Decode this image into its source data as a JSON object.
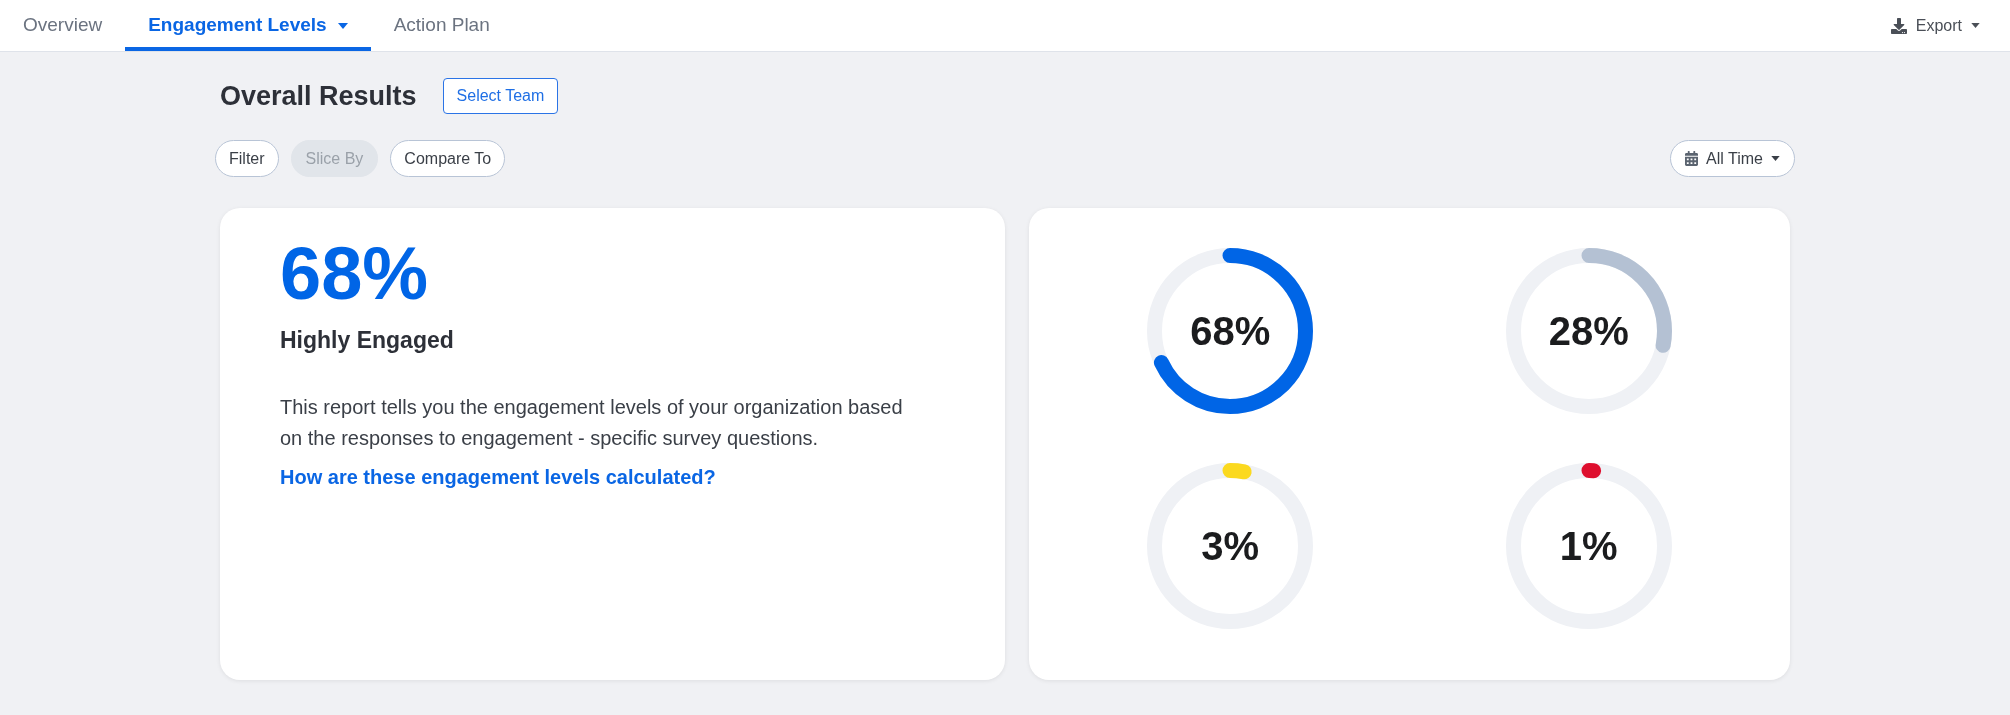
{
  "tabs": [
    {
      "label": "Overview",
      "selected": false,
      "dropdown": false
    },
    {
      "label": "Engagement Levels",
      "selected": true,
      "dropdown": true
    },
    {
      "label": "Action Plan",
      "selected": false,
      "dropdown": false
    }
  ],
  "export_button": {
    "label": "Export"
  },
  "header": {
    "title": "Overall Results",
    "select_team_button": "Select Team"
  },
  "filters": [
    {
      "label": "Filter",
      "disabled": false
    },
    {
      "label": "Slice By",
      "disabled": true
    },
    {
      "label": "Compare To",
      "disabled": false
    }
  ],
  "date_range": {
    "label": "All Time"
  },
  "summary_card": {
    "percentage": "68%",
    "title": "Highly Engaged",
    "description": "This report tells you the engagement levels of your organization based on the responses to engagement - specific survey questions.",
    "link": "How are these engagement levels calculated?"
  },
  "gauges": [
    {
      "reading": "68%",
      "level": 0.68,
      "color": "#0065e6"
    },
    {
      "reading": "28%",
      "level": 0.28,
      "color": "#b4c1d3"
    },
    {
      "reading": "3%",
      "level": 0.03,
      "color": "#fbd91f"
    },
    {
      "reading": "1%",
      "level": 0.01,
      "color": "#de0f2e"
    }
  ]
}
